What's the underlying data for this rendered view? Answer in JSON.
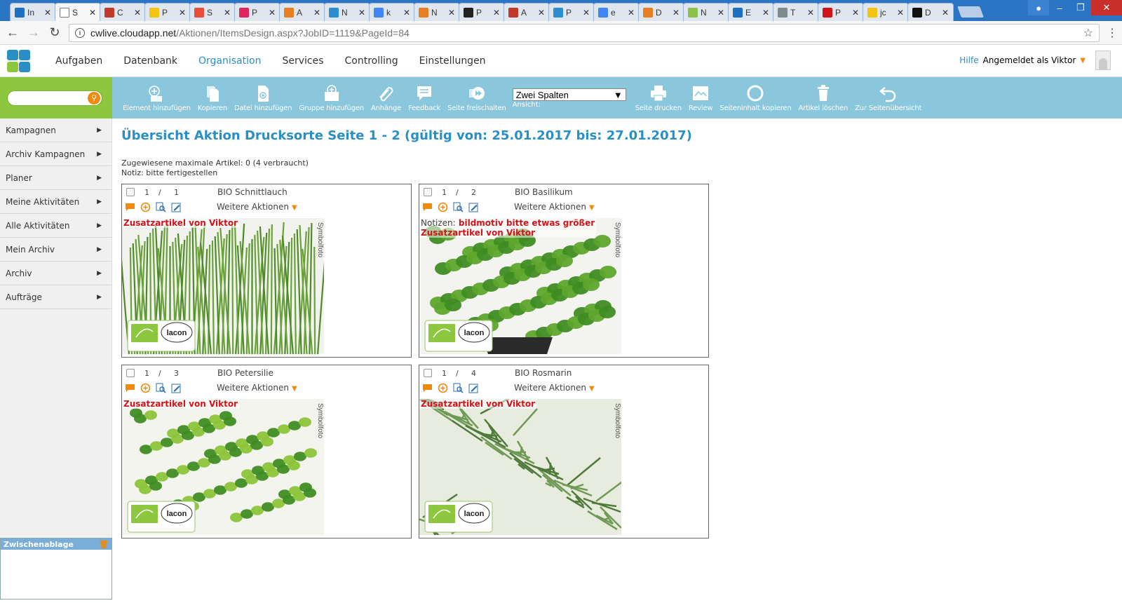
{
  "browser": {
    "tabs": [
      {
        "title": "In",
        "color": "#1f6fc0"
      },
      {
        "title": "S",
        "color": "#ffffff",
        "active": true
      },
      {
        "title": "C",
        "color": "#c0392b"
      },
      {
        "title": "P",
        "color": "#f1c40f"
      },
      {
        "title": "S",
        "color": "#e74c3c"
      },
      {
        "title": "P",
        "color": "#e0245e"
      },
      {
        "title": "A",
        "color": "#e67e22"
      },
      {
        "title": "N",
        "color": "#2c8ecf"
      },
      {
        "title": "k",
        "color": "#4285f4"
      },
      {
        "title": "N",
        "color": "#e67e22"
      },
      {
        "title": "P",
        "color": "#222222"
      },
      {
        "title": "A",
        "color": "#c0392b"
      },
      {
        "title": "P",
        "color": "#2c8ecf"
      },
      {
        "title": "e",
        "color": "#4285f4"
      },
      {
        "title": "D",
        "color": "#e67e22"
      },
      {
        "title": "N",
        "color": "#8bc34a"
      },
      {
        "title": "E",
        "color": "#1f6fc0"
      },
      {
        "title": "T",
        "color": "#7f8c8d"
      },
      {
        "title": "P",
        "color": "#d0141c"
      },
      {
        "title": "jc",
        "color": "#f1c40f"
      },
      {
        "title": "D",
        "color": "#111111"
      }
    ],
    "url_host": "cwlive.cloudapp.net",
    "url_path": "/Aktionen/ItemsDesign.aspx?JobID=1119&PageId=84"
  },
  "nav": {
    "items": [
      "Aufgaben",
      "Datenbank",
      "Organisation",
      "Services",
      "Controlling",
      "Einstellungen"
    ],
    "active": "Organisation",
    "help": "Hilfe",
    "logged_in": "Angemeldet als Viktor"
  },
  "toolbar": {
    "element_add": "Element hinzufügen",
    "copy": "Kopieren",
    "file_add": "Datei hinzufügen",
    "group_add": "Gruppe hinzufügen",
    "attachments": "Anhänge",
    "feedback": "Feedback",
    "page_release": "Seite freischalten",
    "view_value": "Zwei Spalten",
    "view_label": "Ansicht:",
    "print_page": "Seite drucken",
    "review": "Review",
    "copy_page_content": "Seiteninhalt kopieren",
    "delete_article": "Artikel löschen",
    "to_overview": "Zur Seitenübersicht"
  },
  "sidebar": {
    "items": [
      "Kampagnen",
      "Archiv Kampagnen",
      "Planer",
      "Meine Aktivitäten",
      "Alle Aktivitäten",
      "Mein Archiv",
      "Archiv",
      "Aufträge"
    ],
    "clipboard": "Zwischenablage"
  },
  "page": {
    "title": "Übersicht Aktion Drucksorte Seite 1 - 2 (gültig von: 25.01.2017 bis: 27.01.2017)",
    "assigned": "Zugewiesene maximale Artikel: 0 (4 verbraucht)",
    "notice": "Notiz: bitte fertigestellen"
  },
  "articles": [
    {
      "num": "1",
      "slash": "/",
      "pos": "1",
      "name": "BIO Schnittlauch",
      "more": "Weitere Aktionen",
      "note_label": "",
      "note": "",
      "extra": "Zusatzartikel von Viktor",
      "photo_label": "Symbolfoto"
    },
    {
      "num": "1",
      "slash": "/",
      "pos": "2",
      "name": "BIO Basilikum",
      "more": "Weitere Aktionen",
      "note_label": "Notizen:",
      "note": "bildmotiv bitte etwas größer",
      "extra": "Zusatzartikel von Viktor",
      "photo_label": "Symbolfoto"
    },
    {
      "num": "1",
      "slash": "/",
      "pos": "3",
      "name": "BIO Petersilie",
      "more": "Weitere Aktionen",
      "note_label": "",
      "note": "",
      "extra": "Zusatzartikel von Viktor",
      "photo_label": "Symbolfoto"
    },
    {
      "num": "1",
      "slash": "/",
      "pos": "4",
      "name": "BIO Rosmarin",
      "more": "Weitere Aktionen",
      "note_label": "",
      "note": "",
      "extra": "Zusatzartikel von Viktor",
      "photo_label": "Symbolfoto"
    }
  ],
  "colors": {
    "accent": "#2a8fc4",
    "toolbar": "#8ac6dc",
    "search": "#8dc63f",
    "orange": "#f0890c",
    "note_red": "#d0141c"
  }
}
